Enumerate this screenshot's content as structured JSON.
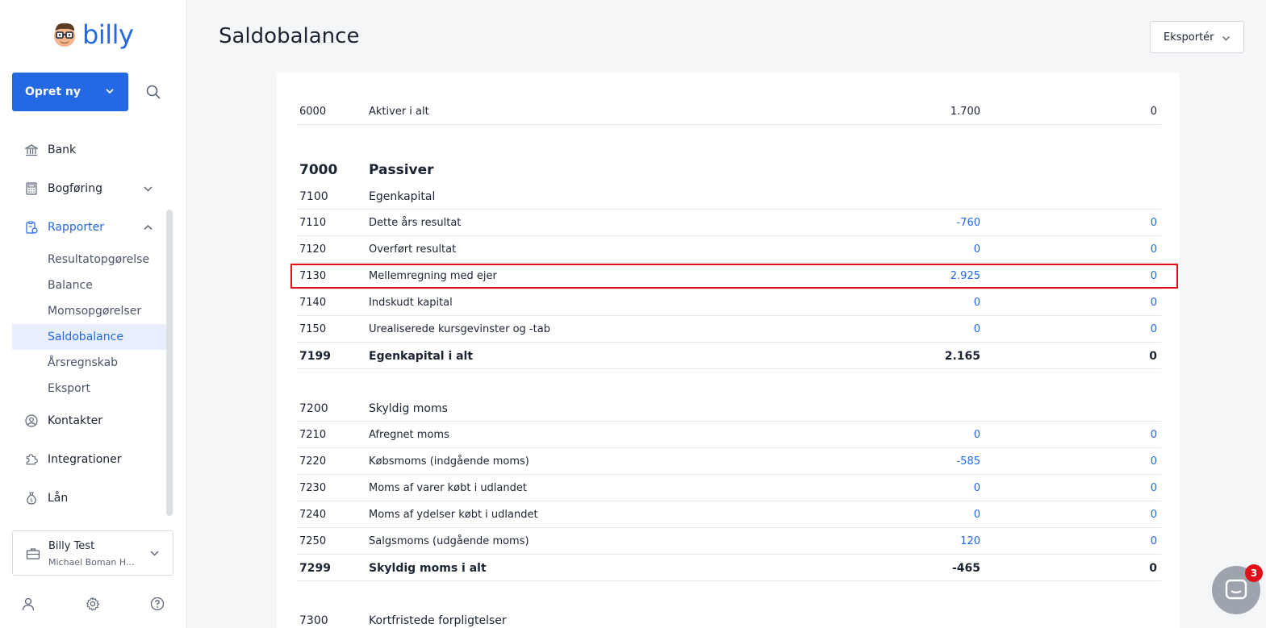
{
  "app": {
    "logo_text": "billy"
  },
  "sidebar": {
    "create_label": "Opret ny",
    "nav": {
      "bank": "Bank",
      "bogforing": "Bogføring",
      "rapporter": "Rapporter",
      "kontakter": "Kontakter",
      "integrationer": "Integrationer",
      "lan": "Lån"
    },
    "sub": {
      "resultat": "Resultatopgørelse",
      "balance": "Balance",
      "moms": "Momsopgørelser",
      "saldo": "Saldobalance",
      "aarsregnskab": "Årsregnskab",
      "eksport": "Eksport"
    },
    "org": {
      "name": "Billy Test",
      "user": "Michael Boman H..."
    }
  },
  "header": {
    "title": "Saldobalance",
    "export_label": "Eksportér"
  },
  "rows": {
    "r6000": {
      "num": "6000",
      "name": "Aktiver i alt",
      "v1": "1.700",
      "v2": "0"
    },
    "r7000": {
      "num": "7000",
      "name": "Passiver"
    },
    "r7100": {
      "num": "7100",
      "name": "Egenkapital"
    },
    "r7110": {
      "num": "7110",
      "name": "Dette års resultat",
      "v1": "-760",
      "v2": "0"
    },
    "r7120": {
      "num": "7120",
      "name": "Overført resultat",
      "v1": "0",
      "v2": "0"
    },
    "r7130": {
      "num": "7130",
      "name": "Mellemregning med ejer",
      "v1": "2.925",
      "v2": "0"
    },
    "r7140": {
      "num": "7140",
      "name": "Indskudt kapital",
      "v1": "0",
      "v2": "0"
    },
    "r7150": {
      "num": "7150",
      "name": "Urealiserede kursgevinster og -tab",
      "v1": "0",
      "v2": "0"
    },
    "r7199": {
      "num": "7199",
      "name": "Egenkapital i alt",
      "v1": "2.165",
      "v2": "0"
    },
    "r7200": {
      "num": "7200",
      "name": "Skyldig moms"
    },
    "r7210": {
      "num": "7210",
      "name": "Afregnet moms",
      "v1": "0",
      "v2": "0"
    },
    "r7220": {
      "num": "7220",
      "name": "Købsmoms (indgående moms)",
      "v1": "-585",
      "v2": "0"
    },
    "r7230": {
      "num": "7230",
      "name": "Moms af varer købt i udlandet",
      "v1": "0",
      "v2": "0"
    },
    "r7240": {
      "num": "7240",
      "name": "Moms af ydelser købt i udlandet",
      "v1": "0",
      "v2": "0"
    },
    "r7250": {
      "num": "7250",
      "name": "Salgsmoms (udgående moms)",
      "v1": "120",
      "v2": "0"
    },
    "r7299": {
      "num": "7299",
      "name": "Skyldig moms i alt",
      "v1": "-465",
      "v2": "0"
    },
    "r7300": {
      "num": "7300",
      "name": "Kortfristede forpligtelser"
    }
  },
  "chat": {
    "badge": "3"
  },
  "colors": {
    "accent": "#2468e3",
    "highlight": "#e0101a"
  }
}
